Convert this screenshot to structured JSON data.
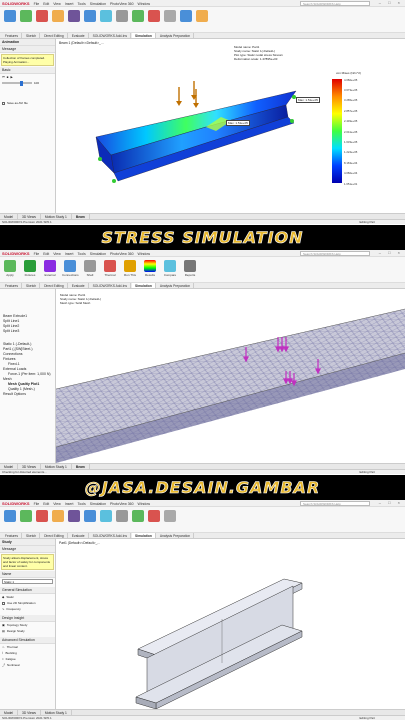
{
  "app": {
    "logo": "SOLIDWORKS",
    "menu": [
      "File",
      "Edit",
      "View",
      "Insert",
      "Tools",
      "Simulation",
      "PhotoView 360",
      "Window"
    ],
    "search_placeholder": "Search SOLIDWORKS Help",
    "window_controls": "– □ ×"
  },
  "ribbon_tabs": [
    "Features",
    "Sketch",
    "Direct Editing",
    "Evaluate",
    "SOLIDWORKS Add-Ins",
    "Simulation",
    "Analysis Preparation"
  ],
  "panel1": {
    "tree_header": "Beam 1 (Default<<Default>_...",
    "side_title": "Animation",
    "side_message_header": "Message",
    "side_message": "Collection of frames completed. Playing Animation...",
    "side_basic": "Basic",
    "side_frames_value": "100",
    "side_save_label": "Save as AVI file",
    "plot_info": [
      "Model name: Part1",
      "Study name: Static 1(-Default-)",
      "Plot type: Static nodal stress Stress1",
      "Deformation scale: 1.47895e+03"
    ],
    "probe_label_1": "Max: 1.51e+05",
    "probe_label_2": "Max: 1.51e+05",
    "legend_unit": "von Mises (N/m^2)",
    "legend_values": [
      "4.082e+05",
      "3.673e+05",
      "3.265e+05",
      "2.857e+05",
      "2.449e+05",
      "2.041e+05",
      "1.633e+05",
      "1.224e+05",
      "8.163e+04",
      "4.082e+04",
      "1.651e+01"
    ],
    "bottom_tabs": [
      "Model",
      "3D Views",
      "Motion Study 1",
      "Beam"
    ],
    "status": "SOLIDWORKS Premium 2021 SP0.1",
    "status_right": "Editing Part"
  },
  "banner1": "STRESS SIMULATION",
  "panel2": {
    "tool_labels": [
      "Apply",
      "Fixtures",
      "External",
      "Connections",
      "Shell",
      "Thermal",
      "Run This",
      "Results",
      "Compare",
      "Reports"
    ],
    "study_info": [
      "Model name: Part1",
      "Study name: Static 1(-Default-)",
      "Mesh type: Solid Mesh"
    ],
    "tree_items": [
      "Beam Extrude1",
      "Split Line1",
      "Split Line2",
      "Split Line3",
      "Static 1 (-Default-)",
      "Part1 (-[SW]Steel-)",
      "Connections",
      "Fixtures",
      "Fixed-1",
      "External Loads",
      "Force-1 (Per item: 1,000 N)",
      "Mesh",
      "Mesh Quality Plot1",
      "Quality 1 (Mesh-)",
      "Result Options"
    ],
    "bottom_tabs": [
      "Model",
      "3D Views",
      "Motion Study 1",
      "Beam"
    ],
    "status": "Checking for distorted elements...",
    "status_right": "Editing Part"
  },
  "banner2": "@JASA.DESAIN.GAMBAR",
  "panel3": {
    "tree_header": "Part1 (Default<<Default>_...",
    "side_title": "Study",
    "side_message_header": "Message",
    "side_message": "Study allows displacement, stress and factor of safety for components and linear content.",
    "side_name_label": "Name",
    "side_name_value": "Static 1",
    "sections": [
      "General Simulation",
      "Static",
      "Use 2D Simplification",
      "Frequency",
      "Design Insight",
      "Topology Study",
      "Design Study",
      "Advanced Simulation",
      "Thermal",
      "Buckling",
      "Fatigue",
      "Nonlinear"
    ],
    "bottom_tabs": [
      "Model",
      "3D Views",
      "Motion Study 1"
    ],
    "status": "SOLIDWORKS Premium 2021 SP0.1",
    "status_right": "Editing Part"
  }
}
